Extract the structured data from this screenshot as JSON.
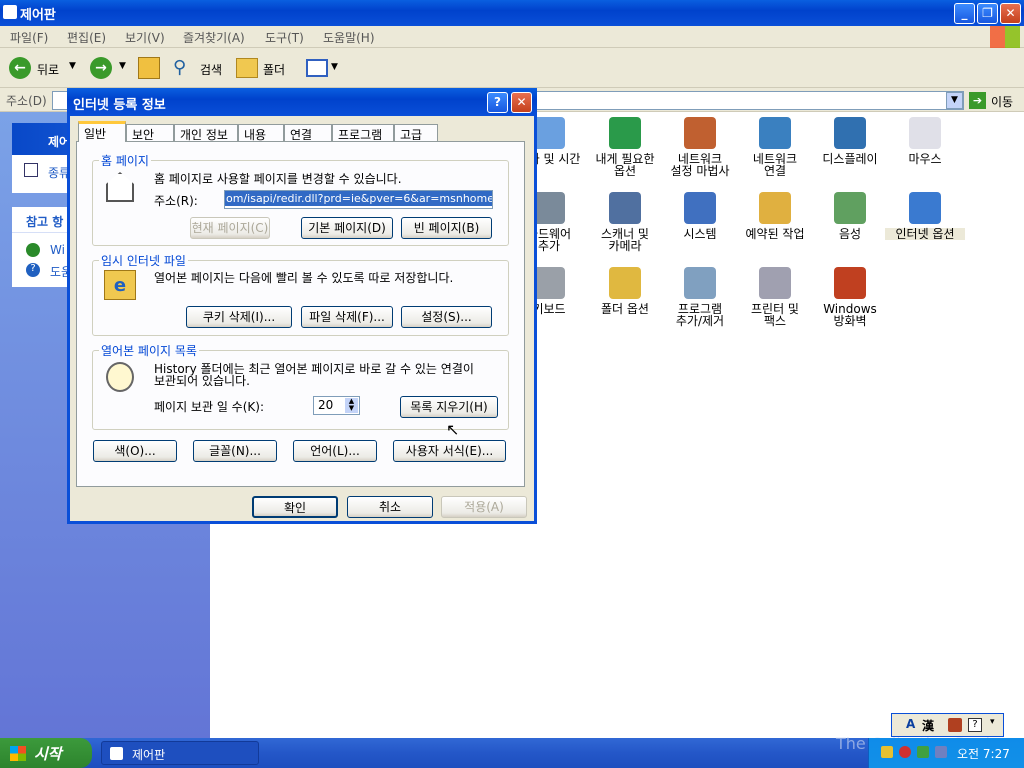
{
  "window": {
    "title": "제어판",
    "menu": [
      "파일(F)",
      "편집(E)",
      "보기(V)",
      "즐겨찾기(A)",
      "도구(T)",
      "도움말(H)"
    ]
  },
  "toolbar": {
    "back": "뒤로",
    "search": "검색",
    "folders": "폴더"
  },
  "address": {
    "label": "주소(D)",
    "go": "이동"
  },
  "sidebar": {
    "panel1_title": "제어",
    "panel1_item": "종류",
    "panel2_title": "참고 항",
    "panel2_items": [
      "Wi",
      "도움"
    ]
  },
  "icons": [
    [
      "날짜 및 시간",
      ""
    ],
    [
      "내게 필요한",
      "옵션"
    ],
    [
      "네트워크",
      "설정 마법사"
    ],
    [
      "네트워크",
      "연결"
    ],
    [
      "디스플레이",
      ""
    ],
    [
      "마우스",
      ""
    ],
    [
      "하드웨어",
      "추가"
    ],
    [
      "스캐너 및",
      "카메라"
    ],
    [
      "시스템",
      ""
    ],
    [
      "예약된 작업",
      ""
    ],
    [
      "음성",
      ""
    ],
    [
      "인터넷 옵션",
      ""
    ],
    [
      "키보드",
      ""
    ],
    [
      "폴더 옵션",
      ""
    ],
    [
      "프로그램",
      "추가/제거"
    ],
    [
      "프린터 및",
      "팩스"
    ],
    [
      "Windows",
      "방화벽"
    ]
  ],
  "dialog": {
    "title": "인터넷 등록 정보",
    "tabs": [
      "일반",
      "보안",
      "개인 정보",
      "내용",
      "연결",
      "프로그램",
      "고급"
    ],
    "home": {
      "group": "홈 페이지",
      "desc": "홈 페이지로 사용할 페이지를 변경할 수 있습니다.",
      "addr_label": "주소(R):",
      "addr_value": "om/isapi/redir.dll?prd=ie&pver=6&ar=msnhome",
      "btn_current": "현재 페이지(C)",
      "btn_default": "기본 페이지(D)",
      "btn_blank": "빈 페이지(B)"
    },
    "temp": {
      "group": "임시 인터넷 파일",
      "desc": "열어본 페이지는 다음에 빨리 볼 수 있도록 따로 저장합니다.",
      "btn_cookies": "쿠키 삭제(I)...",
      "btn_files": "파일 삭제(F)...",
      "btn_settings": "설정(S)..."
    },
    "history": {
      "group": "열어본 페이지 목록",
      "desc1": "History 폴더에는 최근 열어본 페이지로 바로 갈 수 있는 연결이",
      "desc2": "보관되어 있습니다.",
      "days_label": "페이지 보관 일 수(K):",
      "days_value": "20",
      "btn_clear": "목록 지우기(H)"
    },
    "bottom": {
      "colors": "색(O)...",
      "fonts": "글꼴(N)...",
      "languages": "언어(L)...",
      "accessibility": "사용자 서식(E)..."
    },
    "ok": "확인",
    "cancel": "취소",
    "apply": "적용(A)"
  },
  "taskbar": {
    "start": "시작",
    "task": "제어판",
    "clock": "오전 7:27",
    "watermark": "The Collection Book"
  },
  "ime": {
    "a": "A",
    "han": "漢"
  }
}
